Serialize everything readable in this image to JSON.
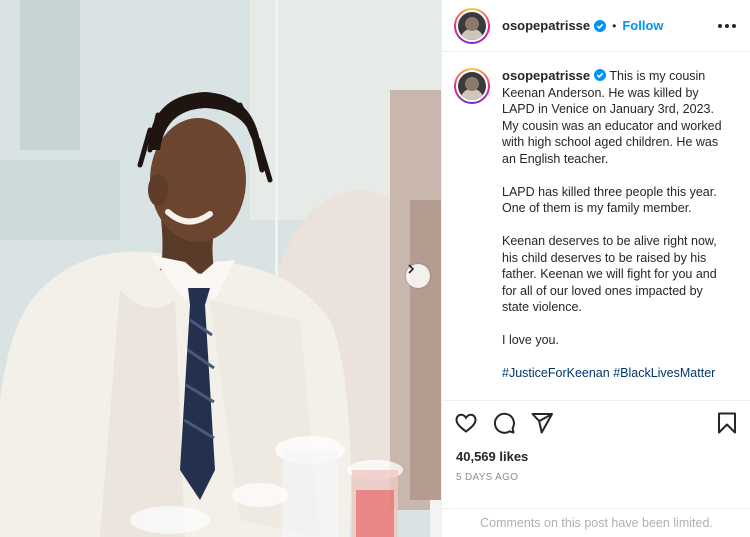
{
  "post": {
    "author": {
      "username": "osopepatrisse",
      "verified_icon": "verified-badge-icon",
      "follow_label": "Follow",
      "separator": "•"
    },
    "caption": {
      "paragraphs": [
        "This is my cousin Keenan Anderson. He was killed by LAPD in Venice on January 3rd, 2023. My cousin was an educator and worked with high school aged children. He was an English teacher.",
        "LAPD has killed three people this year. One of them is my family member.",
        "Keenan deserves to be alive right now, his child deserves to be raised by his father. Keenan we will fight for you and for all of our loved ones impacted by state violence.",
        "I love you."
      ],
      "hashtags": [
        "#JusticeForKeenan",
        "#BlackLivesMatter"
      ]
    },
    "likes": "40,569 likes",
    "time_ago": "5 DAYS AGO",
    "comments_notice": "Comments on this post have been limited."
  },
  "icons": {
    "like": "heart-icon",
    "comment": "comment-icon",
    "share": "send-icon",
    "save": "bookmark-icon",
    "more": "more-options-icon",
    "next": "chevron-right-icon"
  },
  "colors": {
    "accent": "#0095f6",
    "hashtag": "#00376b",
    "muted": "#8e8e8e"
  }
}
